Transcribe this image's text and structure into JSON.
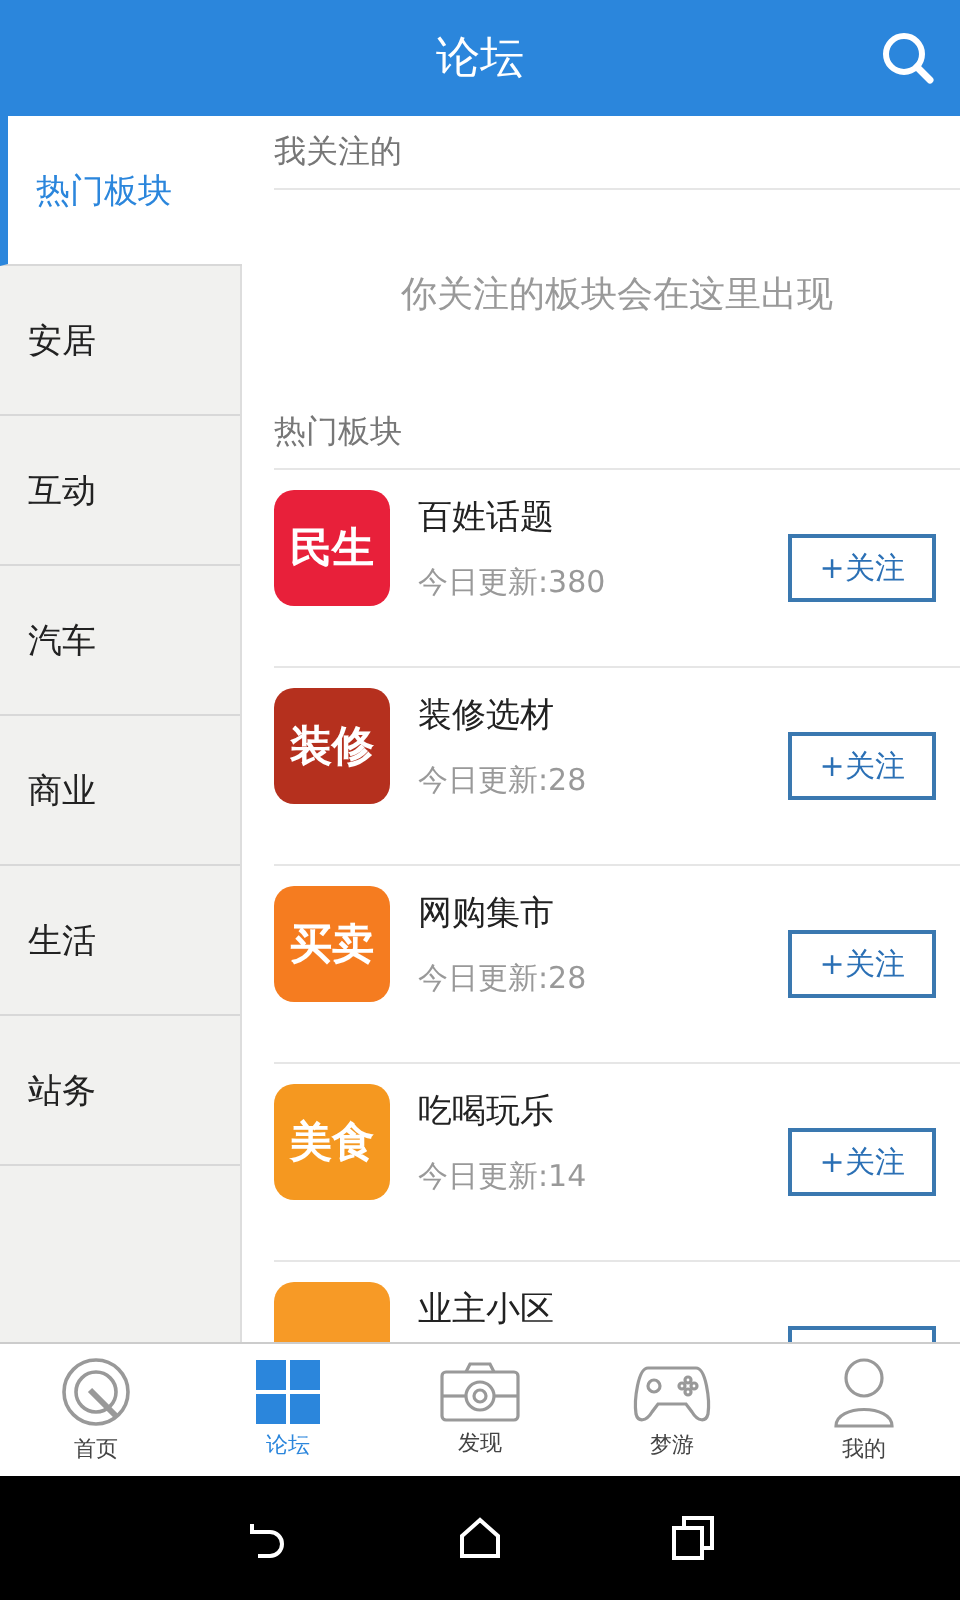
{
  "header": {
    "title": "论坛"
  },
  "sidebar": {
    "items": [
      {
        "label": "热门板块",
        "selected": true
      },
      {
        "label": "安居",
        "selected": false
      },
      {
        "label": "互动",
        "selected": false
      },
      {
        "label": "汽车",
        "selected": false
      },
      {
        "label": "商业",
        "selected": false
      },
      {
        "label": "生活",
        "selected": false
      },
      {
        "label": "站务",
        "selected": false
      }
    ]
  },
  "followed": {
    "heading": "我关注的",
    "empty_message": "你关注的板块会在这里出现"
  },
  "hot": {
    "heading": "热门板块",
    "boards": [
      {
        "badge": "民生",
        "color": "#e8203a",
        "name": "百姓话题",
        "count": "今日更新:380",
        "button": "+关注"
      },
      {
        "badge": "装修",
        "color": "#b5301e",
        "name": "装修选材",
        "count": "今日更新:28",
        "button": "+关注"
      },
      {
        "badge": "买卖",
        "color": "#f57c20",
        "name": "网购集市",
        "count": "今日更新:28",
        "button": "+关注"
      },
      {
        "badge": "美食",
        "color": "#f59820",
        "name": "吃喝玩乐",
        "count": "今日更新:14",
        "button": "+关注"
      },
      {
        "color": "#f79a26",
        "name": "业主小区"
      }
    ]
  },
  "tab_bar": [
    {
      "label": "首页",
      "kind": "home",
      "selected": false
    },
    {
      "label": "论坛",
      "kind": "forum",
      "selected": true
    },
    {
      "label": "发现",
      "kind": "camera",
      "selected": false
    },
    {
      "label": "梦游",
      "kind": "game",
      "selected": false
    },
    {
      "label": "我的",
      "kind": "person",
      "selected": false
    }
  ]
}
